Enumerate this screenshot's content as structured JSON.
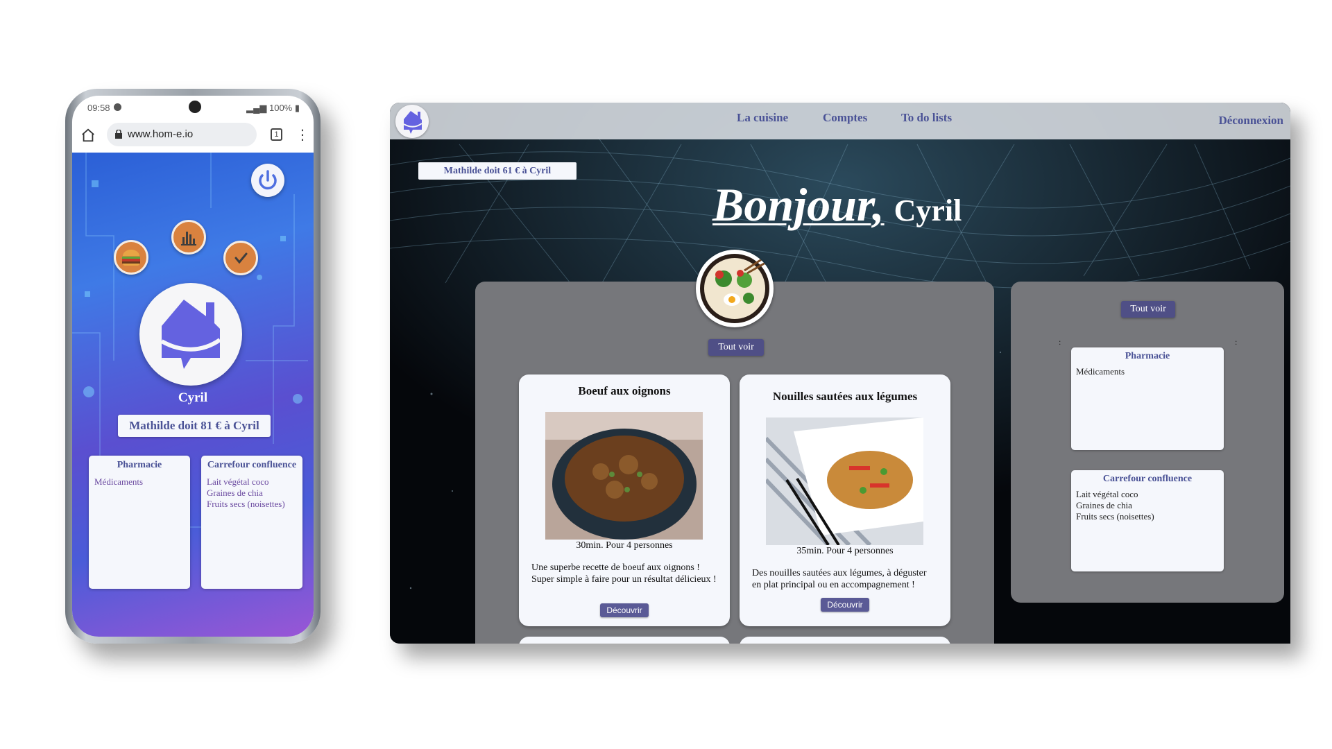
{
  "phone": {
    "time": "09:58",
    "battery": "100%",
    "url": "www.hom-e.io",
    "tab_count": "1",
    "user_name": "Cyril",
    "debt_text": "Mathilde doit 81 € à Cyril",
    "lists": [
      {
        "title": "Pharmacie",
        "items": [
          "Médicaments"
        ]
      },
      {
        "title": "Carrefour confluence",
        "items": [
          "Lait végétal coco",
          "Graines de chia",
          "Fruits secs (noisettes)"
        ]
      }
    ]
  },
  "desktop": {
    "nav": {
      "links": [
        "La cuisine",
        "Comptes",
        "To do lists"
      ],
      "logout": "Déconnexion"
    },
    "debt_text": "Mathilde doit 61 € à Cyril",
    "greeting": "Bonjour,",
    "user_name": "Cyril",
    "kitchen": {
      "see_all": "Tout voir",
      "recipes": [
        {
          "title": "Boeuf aux oignons",
          "meta": "30min.  Pour 4 personnes",
          "description": "Une superbe recette de boeuf aux oignons ! Super simple à faire pour un résultat délicieux !",
          "button": "Découvrir"
        },
        {
          "title": "Nouilles sautées aux légumes",
          "meta": "35min.  Pour 4 personnes",
          "description": "Des nouilles sautées aux légumes, à déguster en plat principal ou en accompagnement !",
          "button": "Découvrir"
        }
      ]
    },
    "todo": {
      "see_all": "Tout voir",
      "lists": [
        {
          "title": "Pharmacie",
          "items": [
            "Médicaments"
          ]
        },
        {
          "title": "Carrefour confluence",
          "items": [
            "Lait végétal coco",
            "Graines de chia",
            "Fruits secs (noisettes)"
          ]
        }
      ]
    }
  },
  "colors": {
    "brand": "#6462e0",
    "accent_text": "#4a5296",
    "orb": "#d9823f",
    "button": "#4f4f86"
  },
  "icons": [
    "home-icon",
    "lock-icon",
    "tabs-icon",
    "menu-icon",
    "power-icon",
    "burger-icon",
    "bar-chart-icon",
    "check-icon",
    "house-logo-icon"
  ]
}
